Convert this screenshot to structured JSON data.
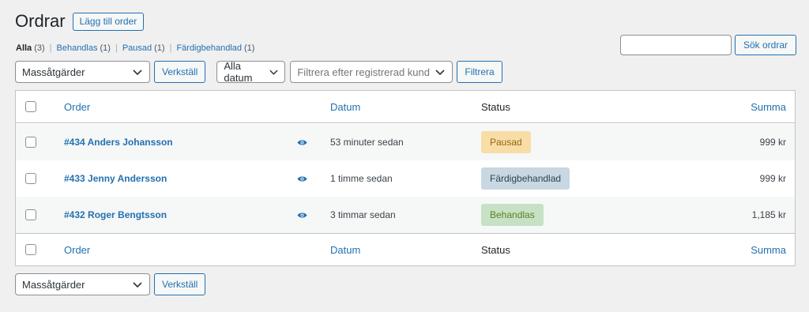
{
  "header": {
    "title": "Ordrar",
    "add_button": "Lägg till order"
  },
  "views": [
    {
      "label": "Alla",
      "count": "(3)"
    },
    {
      "label": "Behandlas",
      "count": "(1)"
    },
    {
      "label": "Pausad",
      "count": "(1)"
    },
    {
      "label": "Färdigbehandlad",
      "count": "(1)"
    }
  ],
  "search": {
    "button": "Sök ordrar",
    "value": ""
  },
  "tablenav_top": {
    "bulk_select": "Massåtgärder",
    "apply": "Verkställ",
    "date_select": "Alla datum",
    "customer_placeholder": "Filtrera efter registrerad kund",
    "filter": "Filtrera"
  },
  "columns": {
    "order": "Order",
    "date": "Datum",
    "status": "Status",
    "total": "Summa"
  },
  "orders": [
    {
      "title": "#434 Anders Johansson",
      "date": "53 minuter sedan",
      "status": "Pausad",
      "status_color": "#f8dda7",
      "total": "999 kr"
    },
    {
      "title": "#433 Jenny Andersson",
      "date": "1 timme sedan",
      "status": "Färdigbehandlad",
      "status_color": "#c8d7e1",
      "total": "999 kr"
    },
    {
      "title": "#432 Roger Bengtsson",
      "date": "3 timmar sedan",
      "status": "Behandlas",
      "status_color": "#c6e1c6",
      "total": "1,185 kr"
    }
  ],
  "tablenav_bottom": {
    "bulk_select": "Massåtgärder",
    "apply": "Verkställ"
  },
  "colors": {
    "accent": "#2271b1",
    "background": "#f0f0f1"
  }
}
